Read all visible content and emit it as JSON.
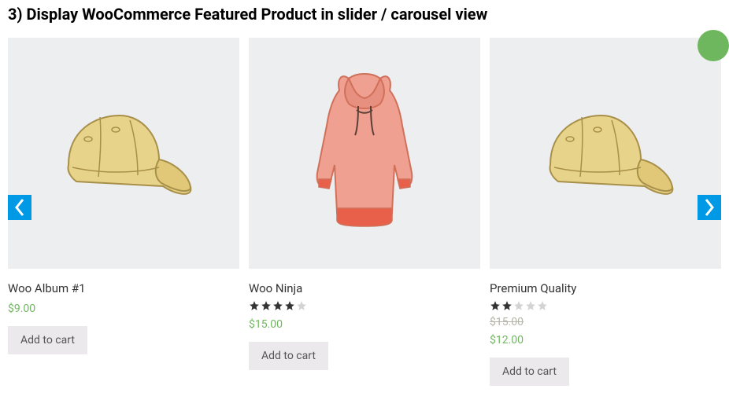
{
  "heading": "3) Display WooCommerce Featured Product in slider / carousel view",
  "products": [
    {
      "title": "Woo Album #1",
      "price": "$9.00",
      "rating": 0,
      "button": "Add to cart",
      "image_type": "cap"
    },
    {
      "title": "Woo Ninja",
      "price": "$15.00",
      "rating": 4,
      "button": "Add to cart",
      "image_type": "hoodie"
    },
    {
      "title": "Premium Quality",
      "price": "$12.00",
      "old_price": "$15.00",
      "rating": 2,
      "button": "Add to cart",
      "image_type": "cap",
      "has_sale_badge": true
    }
  ]
}
